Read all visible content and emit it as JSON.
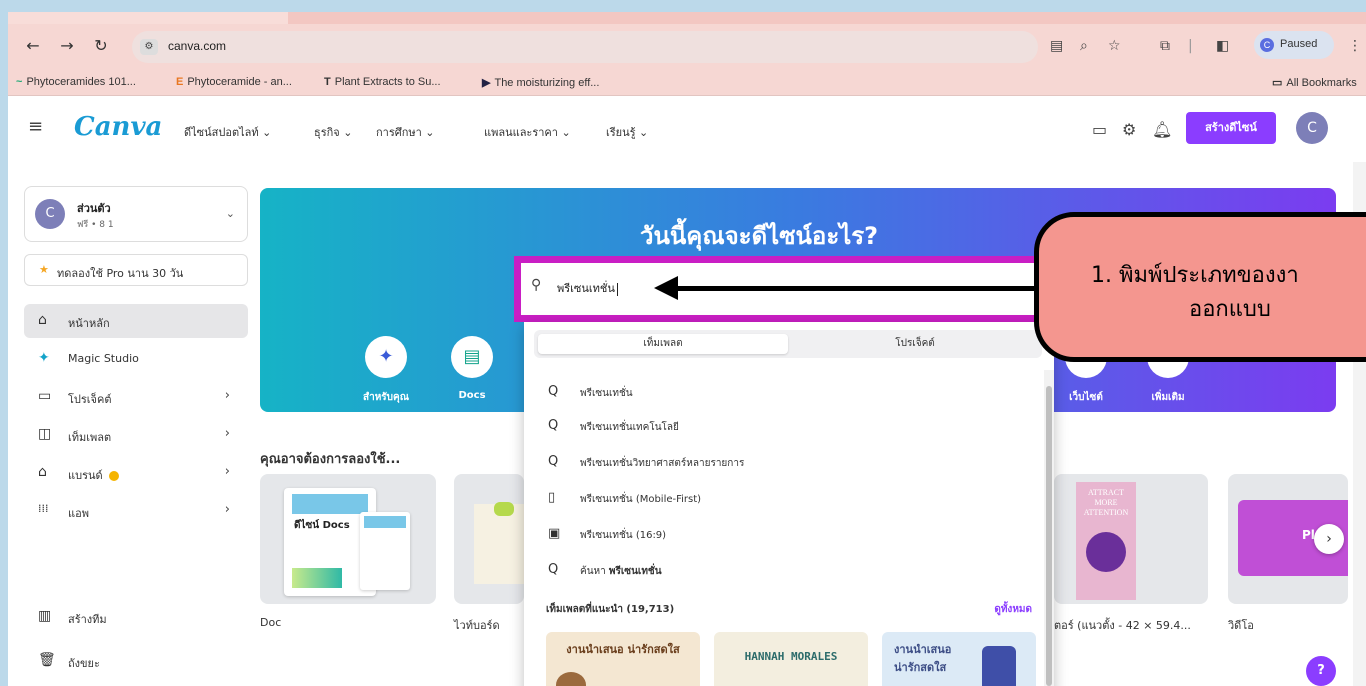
{
  "browser": {
    "url": "canva.com",
    "paused_label": "Paused",
    "bookmarks": [
      "Phytoceramides 101...",
      "Phytoceramide - an...",
      "Plant Extracts to Su...",
      "The moisturizing eff..."
    ],
    "all_bookmarks_label": "All Bookmarks"
  },
  "header": {
    "logo": "Canva",
    "nav": [
      "ดีไซน์สปอตไลท์ ⌄",
      "ธุรกิจ ⌄",
      "การศึกษา ⌄",
      "แพลนและราคา ⌄",
      "เรียนรู้ ⌄"
    ],
    "create_button": "สร้างดีไซน์",
    "avatar_letter": "C"
  },
  "sidebar": {
    "account": {
      "avatar_letter": "C",
      "name": "ส่วนตัว",
      "sub": "ฟรี • 8 1"
    },
    "trial": "ทดลองใช้ Pro นาน 30 วัน",
    "items": [
      {
        "label": "หน้าหลัก",
        "icon": "⌂"
      },
      {
        "label": "Magic Studio",
        "icon": "✦"
      },
      {
        "label": "โปรเจ็คต์",
        "icon": "▭"
      },
      {
        "label": "เท็มเพลต",
        "icon": "◫"
      },
      {
        "label": "แบรนด์",
        "icon": "⌂"
      },
      {
        "label": "แอพ",
        "icon": "⁞⁞⁞"
      },
      {
        "label": "สร้างทีม",
        "icon": "▥"
      },
      {
        "label": "ถังขยะ",
        "icon": "🗑"
      }
    ]
  },
  "hero": {
    "title": "วันนี้คุณจะดีไซน์อะไร?",
    "categories": [
      "สำหรับคุณ",
      "Docs",
      "เว็บไซต์",
      "เพิ่มเติม"
    ]
  },
  "search": {
    "value": "พรีเซนเทชั่น",
    "tabs": [
      "เท็มเพลต",
      "โปรเจ็คต์"
    ],
    "suggestions": [
      {
        "text": "พรีเซนเทชั่น",
        "icon": "Q"
      },
      {
        "text": "พรีเซนเทชั่นเทคโนโลยี",
        "icon": "Q"
      },
      {
        "text": "พรีเซนเทชั่นวิทยาศาสตร์หลายรายการ",
        "icon": "Q"
      },
      {
        "text": "พรีเซนเทชั่น (Mobile-First)",
        "icon": "▯"
      },
      {
        "text": "พรีเซนเทชั่น (16:9)",
        "icon": "▣"
      }
    ],
    "search_for_prefix": "ค้นหา",
    "search_for_term": "พรีเซนเทชั่น",
    "recommended_label": "เท็มเพลตที่แนะนำ (19,713)",
    "see_all": "ดูทั้งหมด",
    "templates": [
      "งานนำเสนอ น่ารักสดใส",
      "HANNAH MORALES",
      "งานนำเสนอ น่ารักสดใส"
    ]
  },
  "try_section": {
    "title": "คุณอาจต้องการลองใช้...",
    "cards": [
      "Doc",
      "ไวท์บอร์ด",
      "",
      "",
      "ตอร์ (แนวตั้ง - 42 × 59.4...",
      "วิดีโอ"
    ],
    "card_texts": {
      "doc_title": "ดีไซน์ Docs",
      "poster": "ATTRACT MORE ATTENTION",
      "video": "Play"
    }
  },
  "callout": {
    "line1": "1. พิมพ์ประเภทของงา",
    "line2": "ออกแบบ"
  },
  "help_label": "?"
}
